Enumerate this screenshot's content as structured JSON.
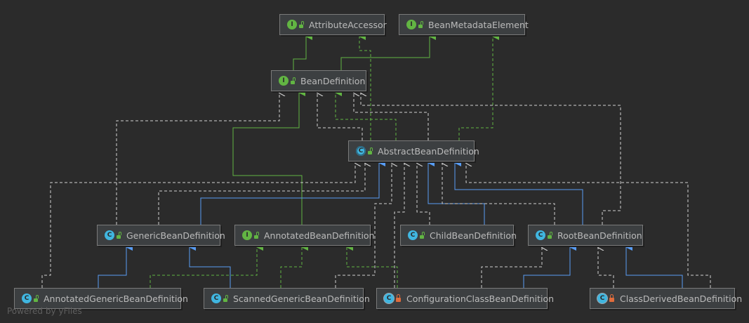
{
  "colors": {
    "background": "#2b2b2b",
    "node_fill": "#3c3f41",
    "node_border": "#7a7a7a",
    "text": "#bbbbbb",
    "interface_badge": "#62b543",
    "class_badge": "#40b6e0",
    "extends_interface_edge": "#62b543",
    "implements_edge": "#62b543",
    "extends_class_edge": "#589df6",
    "dependency_edge": "#d0d0d0"
  },
  "nodes": [
    {
      "id": "attribute_accessor",
      "label": "AttributeAccessor",
      "kind": "interface",
      "badge": "I",
      "visibility": "public"
    },
    {
      "id": "bean_metadata_element",
      "label": "BeanMetadataElement",
      "kind": "interface",
      "badge": "I",
      "visibility": "public"
    },
    {
      "id": "bean_definition",
      "label": "BeanDefinition",
      "kind": "interface",
      "badge": "I",
      "visibility": "public"
    },
    {
      "id": "abstract_bean_definition",
      "label": "AbstractBeanDefinition",
      "kind": "abstract",
      "badge": "C",
      "visibility": "public"
    },
    {
      "id": "generic_bean_definition",
      "label": "GenericBeanDefinition",
      "kind": "class",
      "badge": "C",
      "visibility": "public"
    },
    {
      "id": "annotated_bean_definition",
      "label": "AnnotatedBeanDefinition",
      "kind": "interface",
      "badge": "I",
      "visibility": "public"
    },
    {
      "id": "child_bean_definition",
      "label": "ChildBeanDefinition",
      "kind": "class",
      "badge": "C",
      "visibility": "public"
    },
    {
      "id": "root_bean_definition",
      "label": "RootBeanDefinition",
      "kind": "class",
      "badge": "C",
      "visibility": "public"
    },
    {
      "id": "annotated_generic_bean_definition",
      "label": "AnnotatedGenericBeanDefinition",
      "kind": "class",
      "badge": "C",
      "visibility": "public"
    },
    {
      "id": "scanned_generic_bean_definition",
      "label": "ScannedGenericBeanDefinition",
      "kind": "class",
      "badge": "C",
      "visibility": "public"
    },
    {
      "id": "configuration_class_bean_definition",
      "label": "ConfigurationClassBeanDefinition",
      "kind": "final-class",
      "badge": "C",
      "visibility": "package"
    },
    {
      "id": "class_derived_bean_definition",
      "label": "ClassDerivedBeanDefinition",
      "kind": "final-class",
      "badge": "C",
      "visibility": "package"
    }
  ],
  "watermark": "Powered by yFiles"
}
